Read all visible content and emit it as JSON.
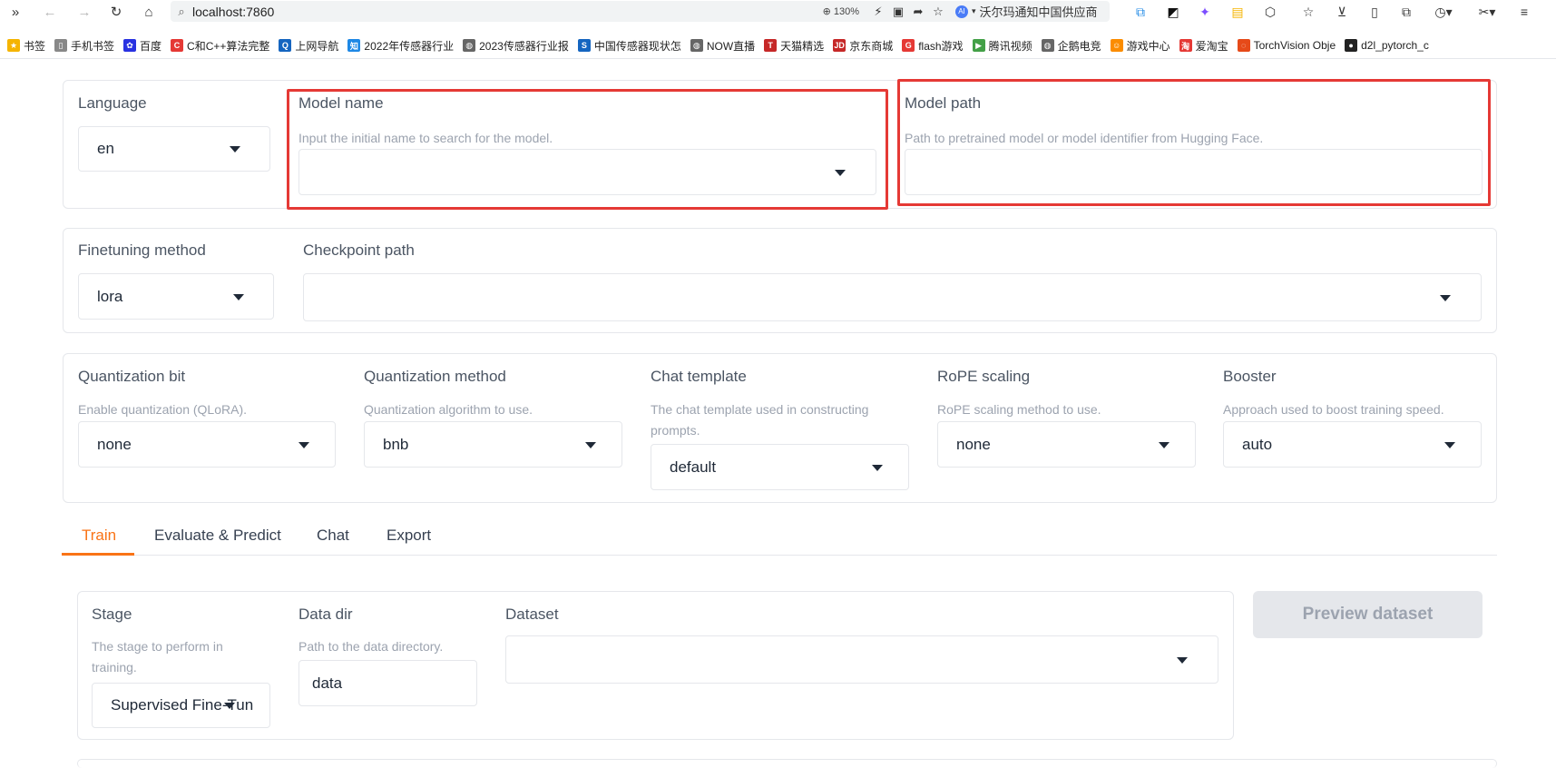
{
  "browser": {
    "url": "localhost:7860",
    "zoom": "130%",
    "ai_text": "沃尔玛通知中国供应商",
    "bookmarks": [
      {
        "label": "书签",
        "color": "#f5b400",
        "glyph": "★"
      },
      {
        "label": "手机书签",
        "color": "#888888",
        "glyph": "▯"
      },
      {
        "label": "百度",
        "color": "#2932e1",
        "glyph": "✿"
      },
      {
        "label": "C和C++算法完整",
        "color": "#e53935",
        "glyph": "C"
      },
      {
        "label": "上网导航",
        "color": "#1565c0",
        "glyph": "Q"
      },
      {
        "label": "2022年传感器行业",
        "color": "#1e88e5",
        "glyph": "知"
      },
      {
        "label": "2023传感器行业报",
        "color": "#666666",
        "glyph": "◍"
      },
      {
        "label": "中国传感器现状怎",
        "color": "#1565c0",
        "glyph": "S"
      },
      {
        "label": "NOW直播",
        "color": "#666666",
        "glyph": "◍"
      },
      {
        "label": "天猫精选",
        "color": "#c62828",
        "glyph": "T"
      },
      {
        "label": "京东商城",
        "color": "#c62828",
        "glyph": "JD"
      },
      {
        "label": "flash游戏",
        "color": "#e53935",
        "glyph": "G"
      },
      {
        "label": "腾讯视频",
        "color": "#43a047",
        "glyph": "▶"
      },
      {
        "label": "企鹅电竞",
        "color": "#666666",
        "glyph": "◍"
      },
      {
        "label": "游戏中心",
        "color": "#fb8c00",
        "glyph": "☺"
      },
      {
        "label": "爱淘宝",
        "color": "#e53935",
        "glyph": "淘"
      },
      {
        "label": "TorchVision Obje",
        "color": "#e64a19",
        "glyph": "◌"
      },
      {
        "label": "d2l_pytorch_c",
        "color": "#222222",
        "glyph": "●"
      }
    ]
  },
  "top": {
    "language": {
      "label": "Language",
      "value": "en"
    },
    "model_name": {
      "label": "Model name",
      "info": "Input the initial name to search for the model.",
      "value": ""
    },
    "model_path": {
      "label": "Model path",
      "info": "Path to pretrained model or model identifier from Hugging Face.",
      "value": ""
    }
  },
  "finetune": {
    "method": {
      "label": "Finetuning method",
      "value": "lora"
    },
    "checkpoint": {
      "label": "Checkpoint path",
      "value": ""
    }
  },
  "advanced": {
    "quant_bit": {
      "label": "Quantization bit",
      "info": "Enable quantization (QLoRA).",
      "value": "none"
    },
    "quant_method": {
      "label": "Quantization method",
      "info": "Quantization algorithm to use.",
      "value": "bnb"
    },
    "template": {
      "label": "Chat template",
      "info": "The chat template used in constructing prompts.",
      "value": "default"
    },
    "rope": {
      "label": "RoPE scaling",
      "info": "RoPE scaling method to use.",
      "value": "none"
    },
    "booster": {
      "label": "Booster",
      "info": "Approach used to boost training speed.",
      "value": "auto"
    }
  },
  "tabs": [
    "Train",
    "Evaluate & Predict",
    "Chat",
    "Export"
  ],
  "train": {
    "stage": {
      "label": "Stage",
      "info": "The stage to perform in training.",
      "value": "Supervised Fine-Tun"
    },
    "data_dir": {
      "label": "Data dir",
      "info": "Path to the data directory.",
      "value": "data"
    },
    "dataset": {
      "label": "Dataset",
      "value": ""
    },
    "preview_button": "Preview dataset"
  },
  "colors": {
    "accent": "#f97316",
    "highlight": "#e53935"
  }
}
